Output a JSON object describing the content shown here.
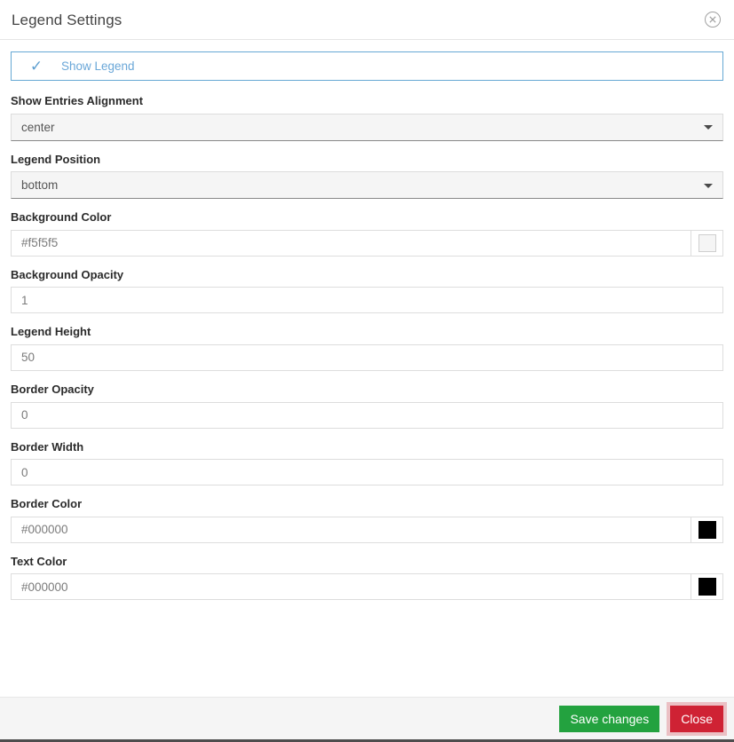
{
  "dialog": {
    "title": "Legend Settings",
    "close_icon": "close-circle-icon"
  },
  "toggle": {
    "label": "Show Legend",
    "checked": true,
    "check_glyph": "✓",
    "accent_color": "#66a8d4"
  },
  "fields": [
    {
      "id": "show-entries-alignment",
      "label": "Show Entries Alignment",
      "type": "select",
      "value": "center"
    },
    {
      "id": "legend-position",
      "label": "Legend Position",
      "type": "select",
      "value": "bottom"
    },
    {
      "id": "background-color",
      "label": "Background Color",
      "type": "color",
      "value": "#f5f5f5",
      "swatch": "#f5f5f5"
    },
    {
      "id": "background-opacity",
      "label": "Background Opacity",
      "type": "text",
      "value": "1"
    },
    {
      "id": "legend-height",
      "label": "Legend Height",
      "type": "text",
      "value": "50"
    },
    {
      "id": "border-opacity",
      "label": "Border Opacity",
      "type": "text",
      "value": "0"
    },
    {
      "id": "border-width",
      "label": "Border Width",
      "type": "text",
      "value": "0"
    },
    {
      "id": "border-color",
      "label": "Border Color",
      "type": "color",
      "value": "#000000",
      "swatch": "#000000"
    },
    {
      "id": "text-color",
      "label": "Text Color",
      "type": "color",
      "value": "#000000",
      "swatch": "#000000"
    }
  ],
  "footer": {
    "save_label": "Save changes",
    "close_label": "Close",
    "save_color": "#23a23f",
    "close_color": "#cf2234"
  }
}
